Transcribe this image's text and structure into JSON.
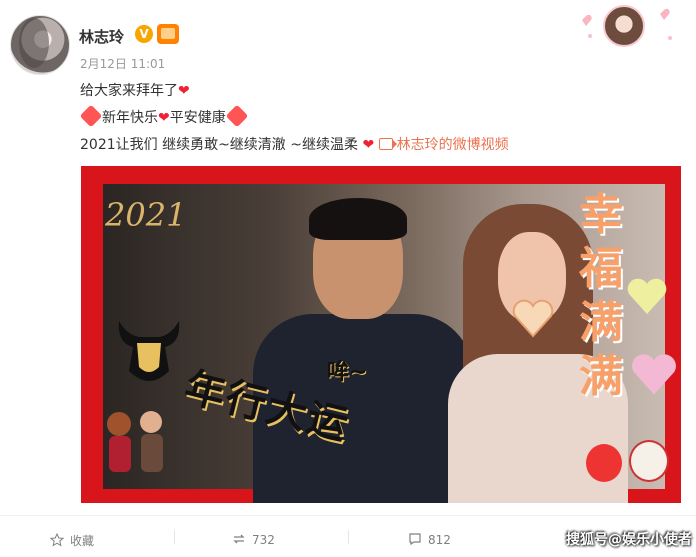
{
  "post": {
    "author": "林志玲",
    "time": "2月12日 11:01",
    "line1": "给大家来拜年了",
    "line2_text1": "新年快乐",
    "line2_text2": "平安健康",
    "line3": "2021让我们 继续勇敢~继续清澈 ~继续温柔",
    "video_link": "林志玲的微博视频"
  },
  "media": {
    "year": "2021",
    "vertical_text": "幸福满满",
    "caption_small": "哞~",
    "caption_main": "年行大运"
  },
  "actions": {
    "collect": "收藏",
    "repost": "732",
    "comment": "812",
    "watermark": "搜狐号@娱乐小使者"
  },
  "colors": {
    "accent": "#eb7350",
    "red_frame": "#d7151b",
    "vip_orange": "#ff8200"
  },
  "icons": [
    "heart-icon",
    "fu-emoji-icon",
    "video-icon",
    "star-icon",
    "repost-icon",
    "comment-icon"
  ]
}
